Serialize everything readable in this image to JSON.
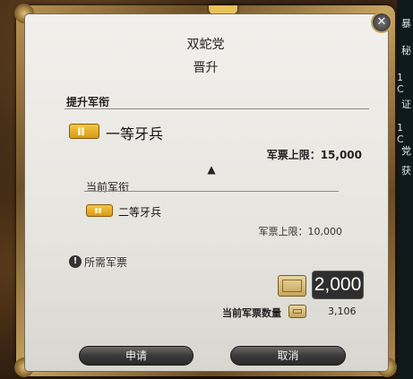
{
  "side_panel": {
    "texts": [
      "暴",
      "秘",
      "1 C",
      "证",
      "1 C",
      "党",
      "获"
    ]
  },
  "dialog": {
    "title": "双蛇党",
    "subtitle": "晋升",
    "close_icon": "close-icon",
    "promote_rank": {
      "section_label": "提升军衔",
      "rank_name": "一等牙兵",
      "cap_text": "军票上限：15,000",
      "rank_icon": "rank-insignia-icon"
    },
    "arrow_icon": "up-arrow-icon",
    "current_rank": {
      "section_label": "当前军衔",
      "rank_name": "二等牙兵",
      "cap_text": "军票上限：10,000",
      "rank_icon": "rank-insignia-icon"
    },
    "requirement": {
      "icon": "exclamation-icon",
      "label": "所需军票",
      "cost": "2,000",
      "seal_icon": "company-seal-icon"
    },
    "current_seals": {
      "label": "当前军票数量",
      "value": "3,106",
      "seal_icon": "company-seal-icon"
    },
    "buttons": {
      "apply": "申请",
      "cancel": "取消"
    },
    "colors": {
      "frame_gold": "#c6a463",
      "panel_bg": "#f1f0ec",
      "button_dark": "#3a3a3a",
      "rank_gold": "#f3c640"
    }
  }
}
